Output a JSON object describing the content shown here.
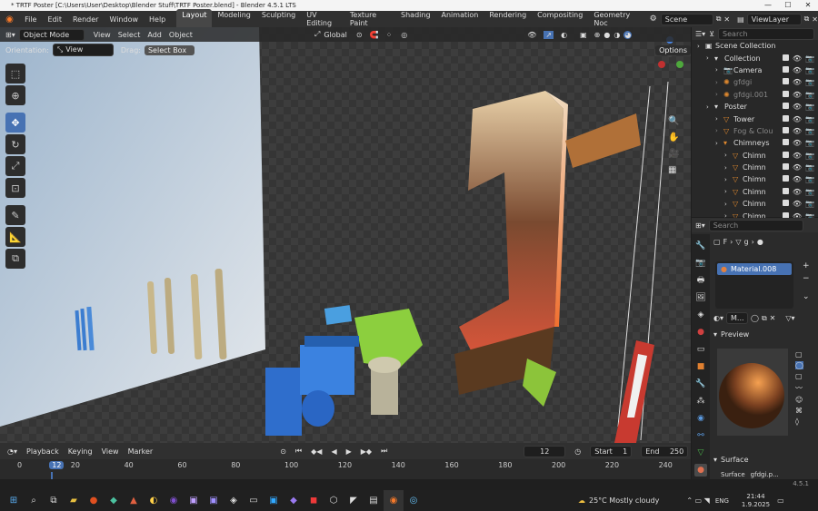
{
  "window": {
    "title": "* TRTF Poster [C:\\Users\\User\\Desktop\\Blender Stuff\\TRTF Poster.blend] - Blender 4.5.1 LTS",
    "minimize": "—",
    "maximize": "☐",
    "close": "✕"
  },
  "menubar": {
    "items": [
      "File",
      "Edit",
      "Render",
      "Window",
      "Help"
    ]
  },
  "workspaces": [
    "Layout",
    "Modeling",
    "Sculpting",
    "UV Editing",
    "Texture Paint",
    "Shading",
    "Animation",
    "Rendering",
    "Compositing",
    "Geometry Noc"
  ],
  "scene": {
    "label": "Scene",
    "view_layer": "ViewLayer"
  },
  "viewport_header": {
    "mode": "Object Mode",
    "menus": [
      "View",
      "Select",
      "Add",
      "Object"
    ],
    "transform": "Global",
    "orientation_label": "Orientation:",
    "orientation": "View",
    "drag_label": "Drag:",
    "drag": "Select Box",
    "options": "Options"
  },
  "outliner": {
    "search_placeholder": "Search",
    "rows": [
      {
        "name": "Scene Collection",
        "indent": 0,
        "icon": "▣",
        "dim": false,
        "vis": false
      },
      {
        "name": "Collection",
        "indent": 1,
        "icon": "▾",
        "dim": false,
        "vis": true
      },
      {
        "name": "Camera",
        "indent": 2,
        "icon": "📷",
        "dim": false,
        "vis": true
      },
      {
        "name": "gfdgi",
        "indent": 2,
        "icon": "✺",
        "dim": true,
        "vis": true
      },
      {
        "name": "gfdgi.001",
        "indent": 2,
        "icon": "✺",
        "dim": true,
        "vis": true
      },
      {
        "name": "Poster",
        "indent": 1,
        "icon": "▾",
        "dim": false,
        "vis": true
      },
      {
        "name": "Tower",
        "indent": 2,
        "icon": "▽",
        "dim": false,
        "vis": true
      },
      {
        "name": "Fog & Clou",
        "indent": 2,
        "icon": "▽",
        "dim": true,
        "vis": true
      },
      {
        "name": "Chimneys",
        "indent": 2,
        "icon": "▾",
        "dim": false,
        "vis": true
      },
      {
        "name": "Chimn",
        "indent": 3,
        "icon": "▽",
        "dim": false,
        "vis": true
      },
      {
        "name": "Chimn",
        "indent": 3,
        "icon": "▽",
        "dim": false,
        "vis": true
      },
      {
        "name": "Chimn",
        "indent": 3,
        "icon": "▽",
        "dim": false,
        "vis": true
      },
      {
        "name": "Chimn",
        "indent": 3,
        "icon": "▽",
        "dim": false,
        "vis": true
      },
      {
        "name": "Chimn",
        "indent": 3,
        "icon": "▽",
        "dim": false,
        "vis": true
      },
      {
        "name": "Chimn",
        "indent": 3,
        "icon": "▽",
        "dim": false,
        "vis": true
      }
    ]
  },
  "properties": {
    "search_placeholder": "Search",
    "breadcrumb": [
      "F",
      "g"
    ],
    "material_slot": "Material.008",
    "material_field": "M...",
    "preview_label": "Preview",
    "surface_label": "Surface",
    "surface_row": "Surface",
    "surface_value": "gfdgi.p..."
  },
  "timeline": {
    "menus": [
      "Playback",
      "Keying",
      "View",
      "Marker"
    ],
    "current_frame": "12",
    "start_label": "Start",
    "start": "1",
    "end_label": "End",
    "end": "250",
    "ticks": [
      "0",
      "12",
      "20",
      "40",
      "60",
      "80",
      "100",
      "120",
      "140",
      "160",
      "180",
      "200",
      "220",
      "240"
    ]
  },
  "status": {
    "version": "4.5.1"
  },
  "taskbar": {
    "weather": "25°C  Mostly cloudy",
    "lang": "ENG",
    "time": "21:44",
    "date": "1.9.2025"
  },
  "colors": {
    "accent": "#4772b3",
    "header": "#303030",
    "active_frame": "#4772b3"
  }
}
